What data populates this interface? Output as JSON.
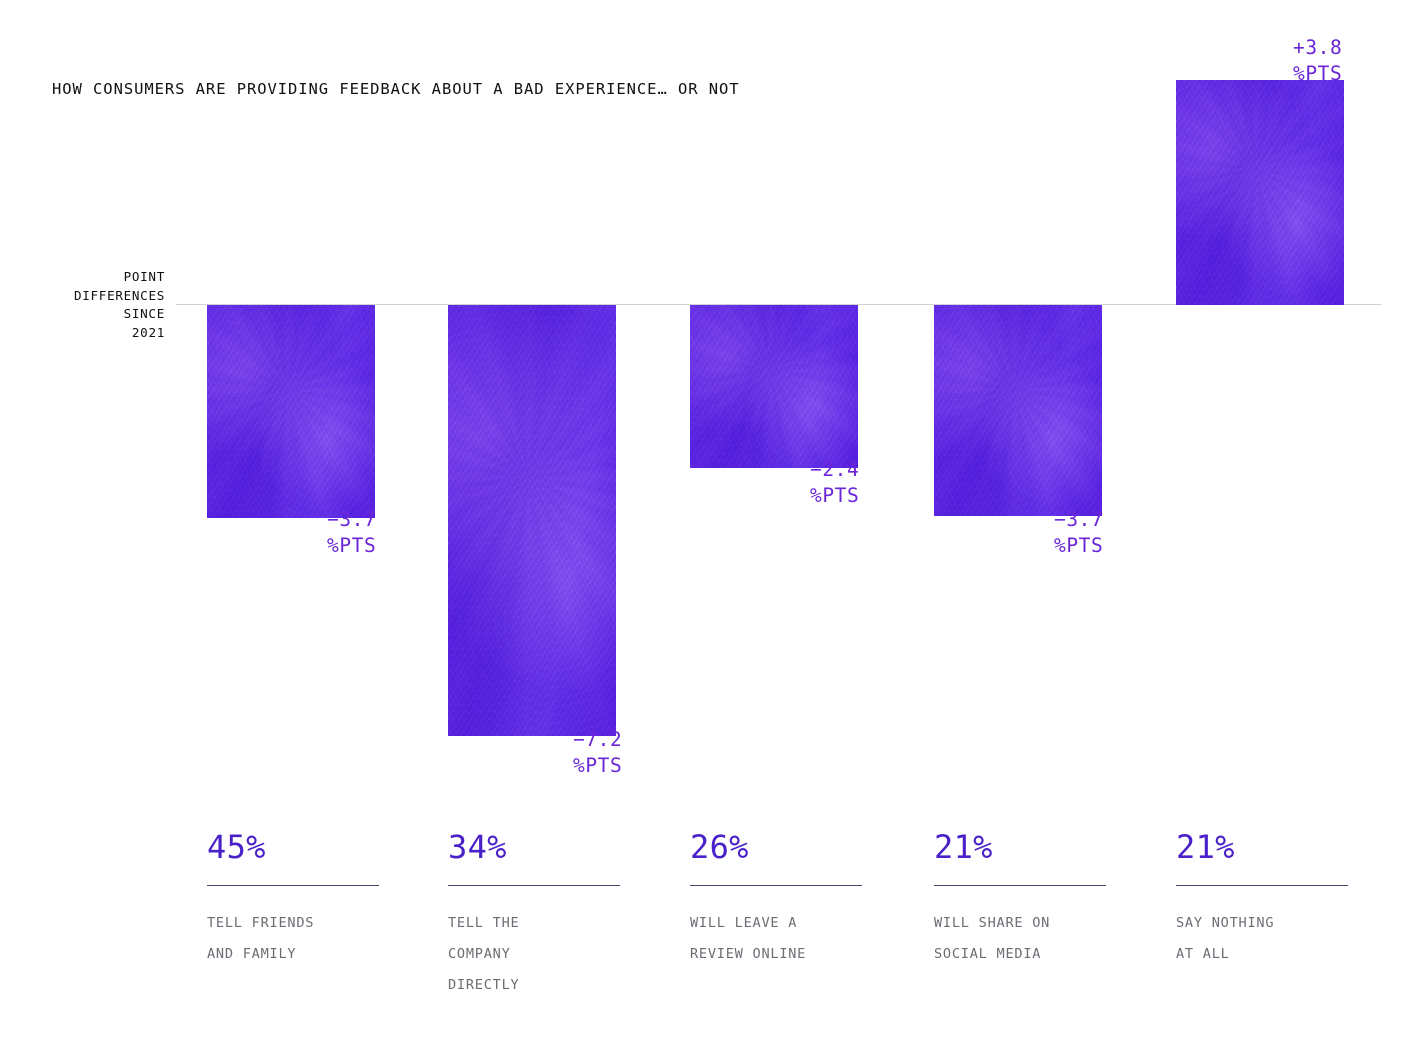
{
  "title": "HOW CONSUMERS ARE PROVIDING FEEDBACK ABOUT A BAD EXPERIENCE… OR NOT",
  "axis_caption": [
    "POINT",
    "DIFFERENCES",
    "SINCE",
    "2021"
  ],
  "colors": {
    "bar": "#5a22e0",
    "value_label": "#6a26d8",
    "stat_percent": "#4a21c9",
    "stat_label": "#6c6c74",
    "rule": "#4a4566",
    "zero_line": "#d2d2d6",
    "title": "#111111"
  },
  "chart_data": {
    "type": "bar",
    "title": "HOW CONSUMERS ARE PROVIDING FEEDBACK ABOUT A BAD EXPERIENCE… OR NOT",
    "xlabel": "",
    "ylabel": "POINT DIFFERENCES SINCE 2021",
    "unit": "%PTS",
    "ylim": [
      -7.2,
      3.8
    ],
    "grid": false,
    "legend": "none",
    "zero_baseline": true,
    "categories": [
      "TELL FRIENDS AND FAMILY",
      "TELL THE COMPANY DIRECTLY",
      "WILL LEAVE A REVIEW ONLINE",
      "WILL SHARE ON SOCIAL MEDIA",
      "SAY NOTHING AT ALL"
    ],
    "values": [
      -3.7,
      -7.2,
      -2.4,
      -3.7,
      3.8
    ],
    "value_labels": [
      "−3.7",
      "−7.2",
      "−2.4",
      "−3.7",
      "+3.8"
    ],
    "share_percent": [
      45,
      34,
      26,
      21,
      21
    ],
    "share_percent_labels": [
      "45%",
      "34%",
      "26%",
      "21%",
      "21%"
    ]
  },
  "bars": [
    {
      "value_line1": "−3.7",
      "value_line2": "%PTS",
      "percent": "45%",
      "label_lines": [
        "TELL FRIENDS",
        "AND FAMILY"
      ]
    },
    {
      "value_line1": "−7.2",
      "value_line2": "%PTS",
      "percent": "34%",
      "label_lines": [
        "TELL THE",
        "COMPANY",
        "DIRECTLY"
      ]
    },
    {
      "value_line1": "−2.4",
      "value_line2": "%PTS",
      "percent": "26%",
      "label_lines": [
        "WILL LEAVE A",
        "REVIEW ONLINE"
      ]
    },
    {
      "value_line1": "−3.7",
      "value_line2": "%PTS",
      "percent": "21%",
      "label_lines": [
        "WILL SHARE ON",
        "SOCIAL MEDIA"
      ]
    },
    {
      "value_line1": "+3.8",
      "value_line2": "%PTS",
      "percent": "21%",
      "label_lines": [
        "SAY NOTHING",
        "AT ALL"
      ]
    }
  ]
}
